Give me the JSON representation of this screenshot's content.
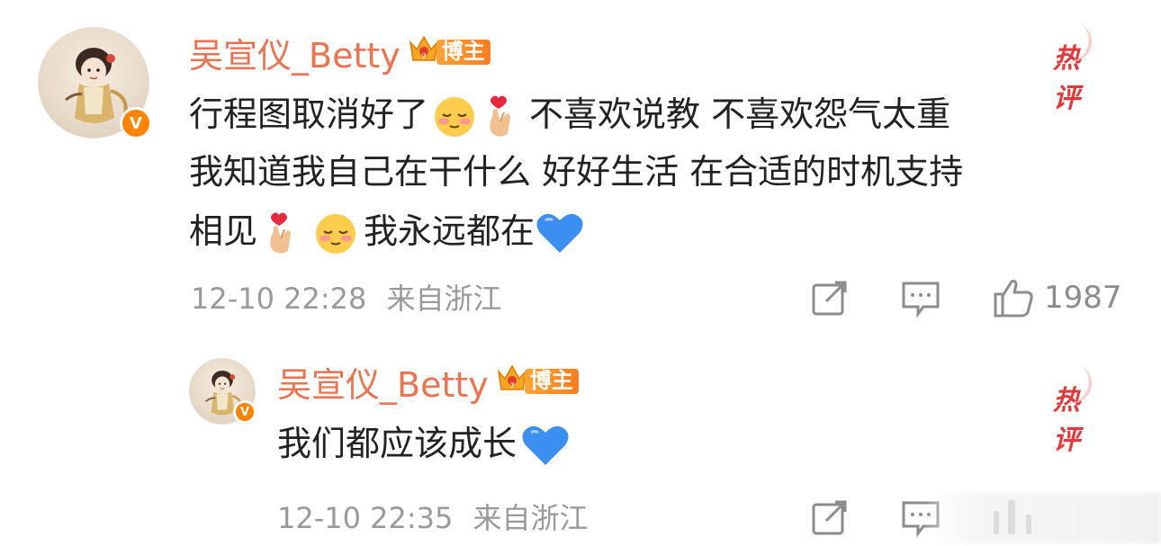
{
  "colors": {
    "username": "#eb7350",
    "hot": "#e4393c",
    "verified": "#ff8200",
    "meta": "#9a9a9a",
    "text": "#222222"
  },
  "comment1": {
    "username": "吴宣仪_Betty",
    "badge_label": "博主",
    "badge_icon": "crown-icon",
    "hot_label": "热评",
    "line1_a": "行程图取消好了",
    "line1_b": "不喜欢说教 不喜欢怨气太重",
    "line2": "我知道我自己在干什么 好好生活 在合适的时机支持",
    "line3_a": "相见",
    "line3_b": "我永远都在",
    "date": "12-10 22:28",
    "location": "来自浙江",
    "like_count": "1987"
  },
  "comment2": {
    "username": "吴宣仪_Betty",
    "badge_label": "博主",
    "badge_icon": "crown-icon",
    "hot_label": "热评",
    "text": "我们都应该成长",
    "date": "12-10 22:35",
    "location": "来自浙江"
  }
}
